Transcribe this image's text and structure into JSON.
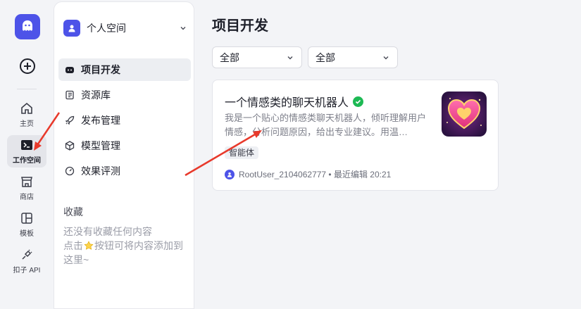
{
  "rail": {
    "items": [
      {
        "label": "主页",
        "icon": "home-icon"
      },
      {
        "label": "工作空间",
        "icon": "terminal-icon"
      },
      {
        "label": "商店",
        "icon": "store-icon"
      },
      {
        "label": "模板",
        "icon": "template-icon"
      },
      {
        "label": "扣子 API",
        "icon": "plug-icon"
      }
    ]
  },
  "sidebar": {
    "space_name": "个人空间",
    "nav": [
      {
        "label": "项目开发",
        "icon": "bot-icon"
      },
      {
        "label": "资源库",
        "icon": "library-icon"
      },
      {
        "label": "发布管理",
        "icon": "rocket-icon"
      },
      {
        "label": "模型管理",
        "icon": "cube-icon"
      },
      {
        "label": "效果评测",
        "icon": "gauge-icon"
      }
    ],
    "favorites_title": "收藏",
    "favorites_empty_1": "还没有收藏任何内容",
    "favorites_empty_2a": "点击",
    "favorites_empty_2b": "按钮可将内容添加到这里~"
  },
  "main": {
    "title": "项目开发",
    "filter1": "全部",
    "filter2": "全部",
    "card": {
      "title": "一个情感类的聊天机器人",
      "description": "我是一个贴心的情感类聊天机器人，倾听理解用户情感，分析问题原因，给出专业建议。用温…",
      "tag": "智能体",
      "meta": "RootUser_2104062777 • 最近编辑 20:21"
    }
  },
  "colors": {
    "accent": "#4d53e8",
    "verified": "#1db954",
    "arrow": "#e8392b"
  }
}
